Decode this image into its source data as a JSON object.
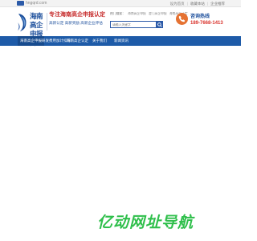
{
  "topbar": {
    "site_url": "hngqrd.com",
    "links": [
      "设为首页",
      "收藏本站",
      "企业推荐"
    ]
  },
  "header": {
    "logo_line1": "海南高企",
    "logo_line2": "申报网",
    "slogan": "专注海南高企申报认定",
    "sub_slogan": "高新认定 高新奖励 高新企业评估",
    "hot_label": "热门搜索：",
    "hot_keywords": [
      "海南高企申报",
      "澄门高企申报",
      "海南高企认定"
    ],
    "search_placeholder": "请输入关键字",
    "hotline_label": "咨询热线",
    "hotline_number": "189-7668-1413"
  },
  "nav": {
    "items": [
      "海南高企申报",
      "研发费用加计扣除",
      "海南高企认定",
      "关于我们",
      "新闻资讯"
    ]
  },
  "watermark": {
    "text": "亿动网址导航"
  },
  "colors": {
    "brand_blue": "#1e5ba8",
    "accent_red": "#d9322b",
    "accent_orange": "#e57232",
    "watermark_green": "#2fbf4b"
  }
}
